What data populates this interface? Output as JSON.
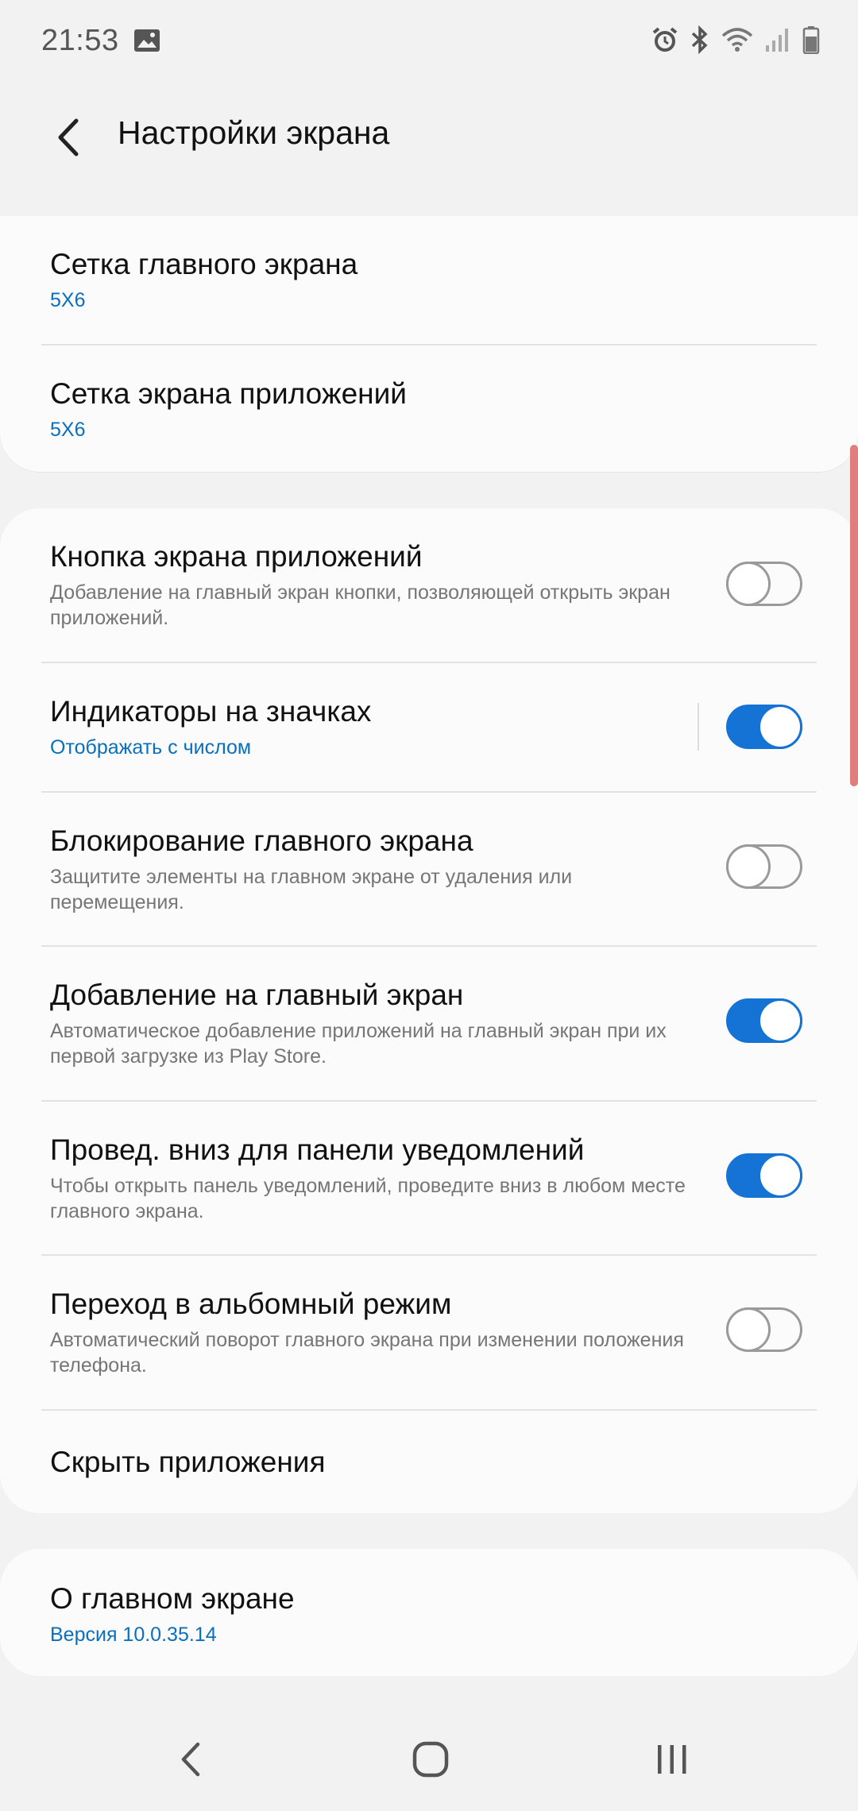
{
  "status_bar": {
    "time": "21:53",
    "icons": [
      "gallery-icon",
      "alarm-icon",
      "bluetooth-icon",
      "wifi-icon",
      "signal-icon",
      "battery-icon"
    ]
  },
  "header": {
    "title": "Настройки экрана",
    "back_icon": "chevron-left-icon"
  },
  "group_grid": {
    "items": [
      {
        "title": "Сетка главного экрана",
        "value": "5X6"
      },
      {
        "title": "Сетка экрана приложений",
        "value": "5X6"
      }
    ]
  },
  "group_settings": {
    "items": [
      {
        "title": "Кнопка экрана приложений",
        "description": "Добавление на главный экран кнопки, позволяющей открыть экран приложений.",
        "toggle": false
      },
      {
        "title": "Индикаторы на значках",
        "value": "Отображать с числом",
        "toggle": true
      },
      {
        "title": "Блокирование главного экрана",
        "description": "Защитите элементы на главном экране от удаления или перемещения.",
        "toggle": false
      },
      {
        "title": "Добавление на главный экран",
        "description": "Автоматическое добавление приложений на главный экран при их первой загрузке из Play Store.",
        "toggle": true
      },
      {
        "title": "Провед. вниз для панели уведомлений",
        "description": "Чтобы открыть панель уведомлений, проведите вниз в любом месте главного экрана.",
        "toggle": true
      },
      {
        "title": "Переход в альбомный режим",
        "description": "Автоматический поворот главного экрана при изменении положения телефона.",
        "toggle": false
      },
      {
        "title": "Скрыть приложения"
      }
    ]
  },
  "about": {
    "title": "О главном экране",
    "version": "Версия 10.0.35.14"
  },
  "colors": {
    "accent": "#1573d6",
    "link_text": "#0a6fbd",
    "background": "#f2f2f2",
    "card": "#fbfbfb"
  },
  "nav_bar": {
    "icons": [
      "back-nav-icon",
      "home-nav-icon",
      "recents-nav-icon"
    ]
  }
}
